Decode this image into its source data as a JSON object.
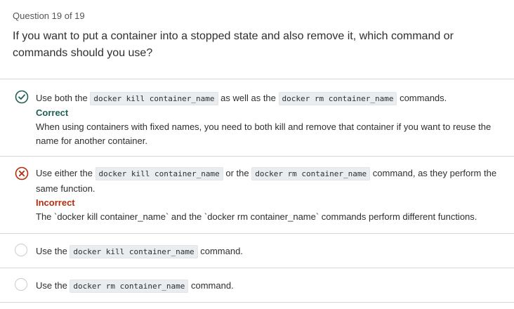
{
  "question": {
    "counter": "Question 19 of 19",
    "text": "If you want to put a container into a stopped state and also remove it, which command or commands should you use?"
  },
  "options": [
    {
      "parts": [
        "Use both the ",
        "docker kill container_name",
        " as well as the ",
        "docker rm container_name",
        " commands."
      ],
      "status": "Correct",
      "explanation": "When using containers with fixed names, you need to both kill and remove that container if you want to reuse the name for another container.",
      "icon": "check-circle-icon",
      "color": "#1e6055"
    },
    {
      "parts": [
        "Use either the ",
        "docker kill container_name",
        " or the ",
        "docker rm container_name",
        " command, as they perform the same function."
      ],
      "status": "Incorrect",
      "explanation": "The `docker kill container_name` and the `docker rm container_name` commands perform different functions.",
      "icon": "x-circle-icon",
      "color": "#b32d0f"
    },
    {
      "parts": [
        "Use the ",
        "docker kill container_name",
        " command."
      ],
      "icon": "radio-unselected"
    },
    {
      "parts": [
        "Use the ",
        "docker rm container_name",
        " command."
      ],
      "icon": "radio-unselected"
    }
  ]
}
